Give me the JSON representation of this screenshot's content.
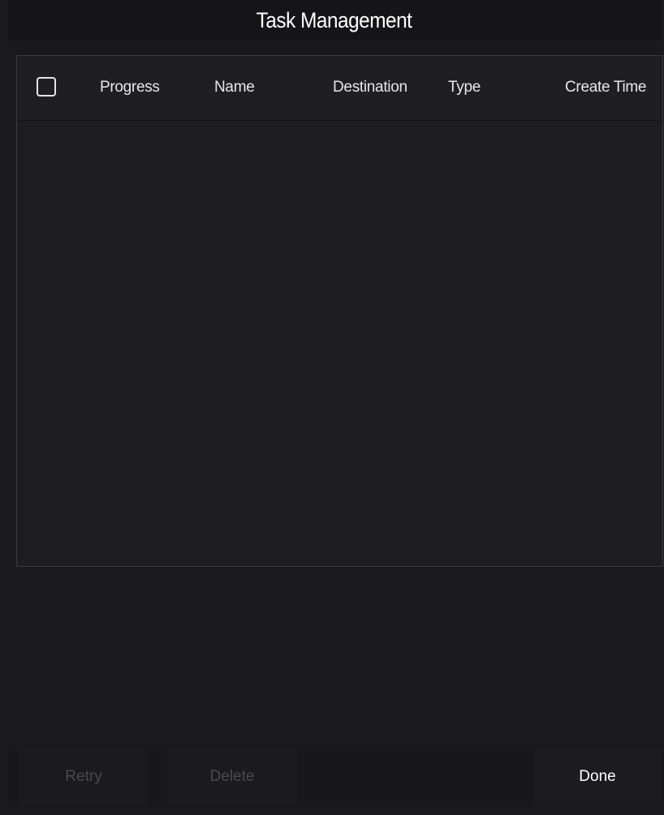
{
  "window": {
    "title": "Task Management"
  },
  "table": {
    "select_all_checked": false,
    "columns": [
      "Progress",
      "Name",
      "Destination",
      "Type",
      "Create Time"
    ],
    "rows": []
  },
  "buttons": {
    "retry_label": "Retry",
    "delete_label": "Delete",
    "done_label": "Done"
  },
  "colors": {
    "background": "#1a1a1d",
    "text": "#e6e6e6",
    "disabled_text": "#4a4a4f",
    "panel_border": "#3b3b40"
  }
}
